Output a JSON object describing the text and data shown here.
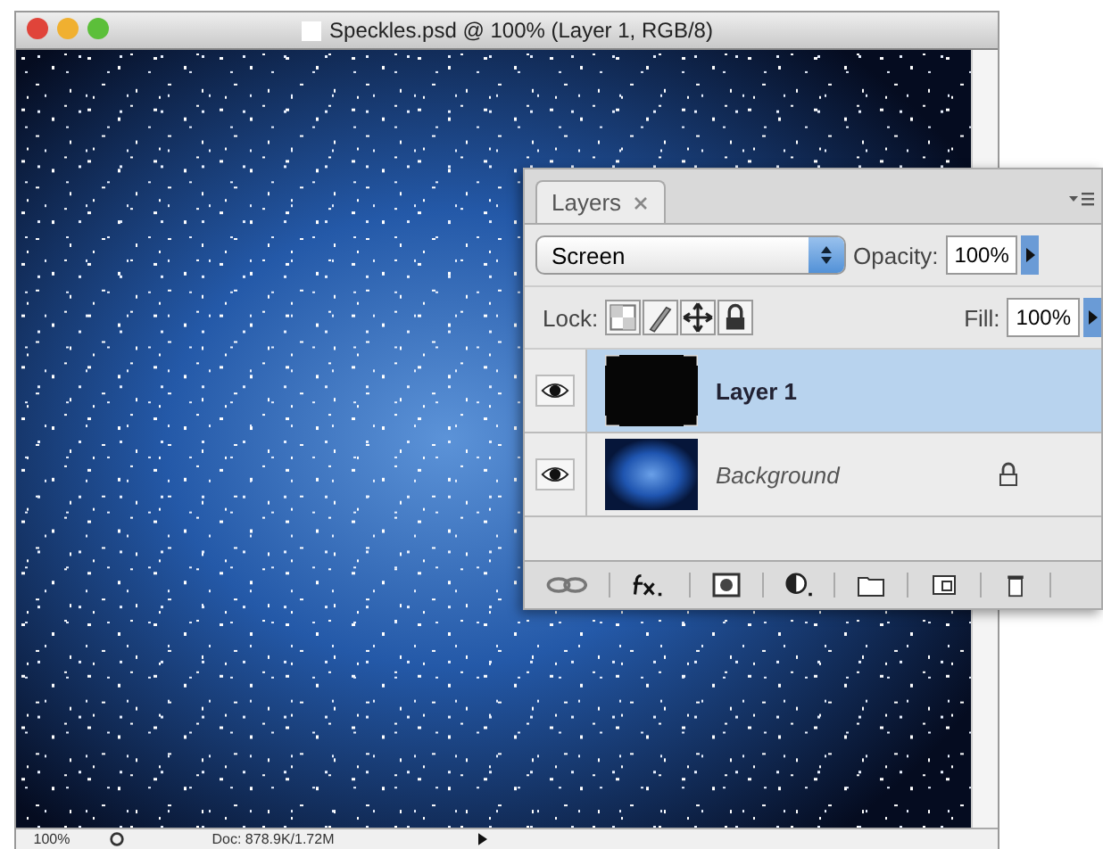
{
  "window": {
    "title": "Speckles.psd @ 100% (Layer 1, RGB/8)"
  },
  "status_bar": {
    "zoom": "100%",
    "doc_info": "Doc: 878.9K/1.72M"
  },
  "layers_panel": {
    "tabs": [
      {
        "label": "Layers",
        "selected": true
      }
    ],
    "blend_mode": "Screen",
    "opacity_label": "Opacity:",
    "opacity": "100%",
    "lock_label": "Lock:",
    "fill_label": "Fill:",
    "fill": "100%",
    "layers": [
      {
        "name": "Layer 1",
        "kind": "dark",
        "selected": true,
        "visible": true,
        "locked": false
      },
      {
        "name": "Background",
        "kind": "gradient",
        "selected": false,
        "visible": true,
        "locked": true
      }
    ]
  }
}
